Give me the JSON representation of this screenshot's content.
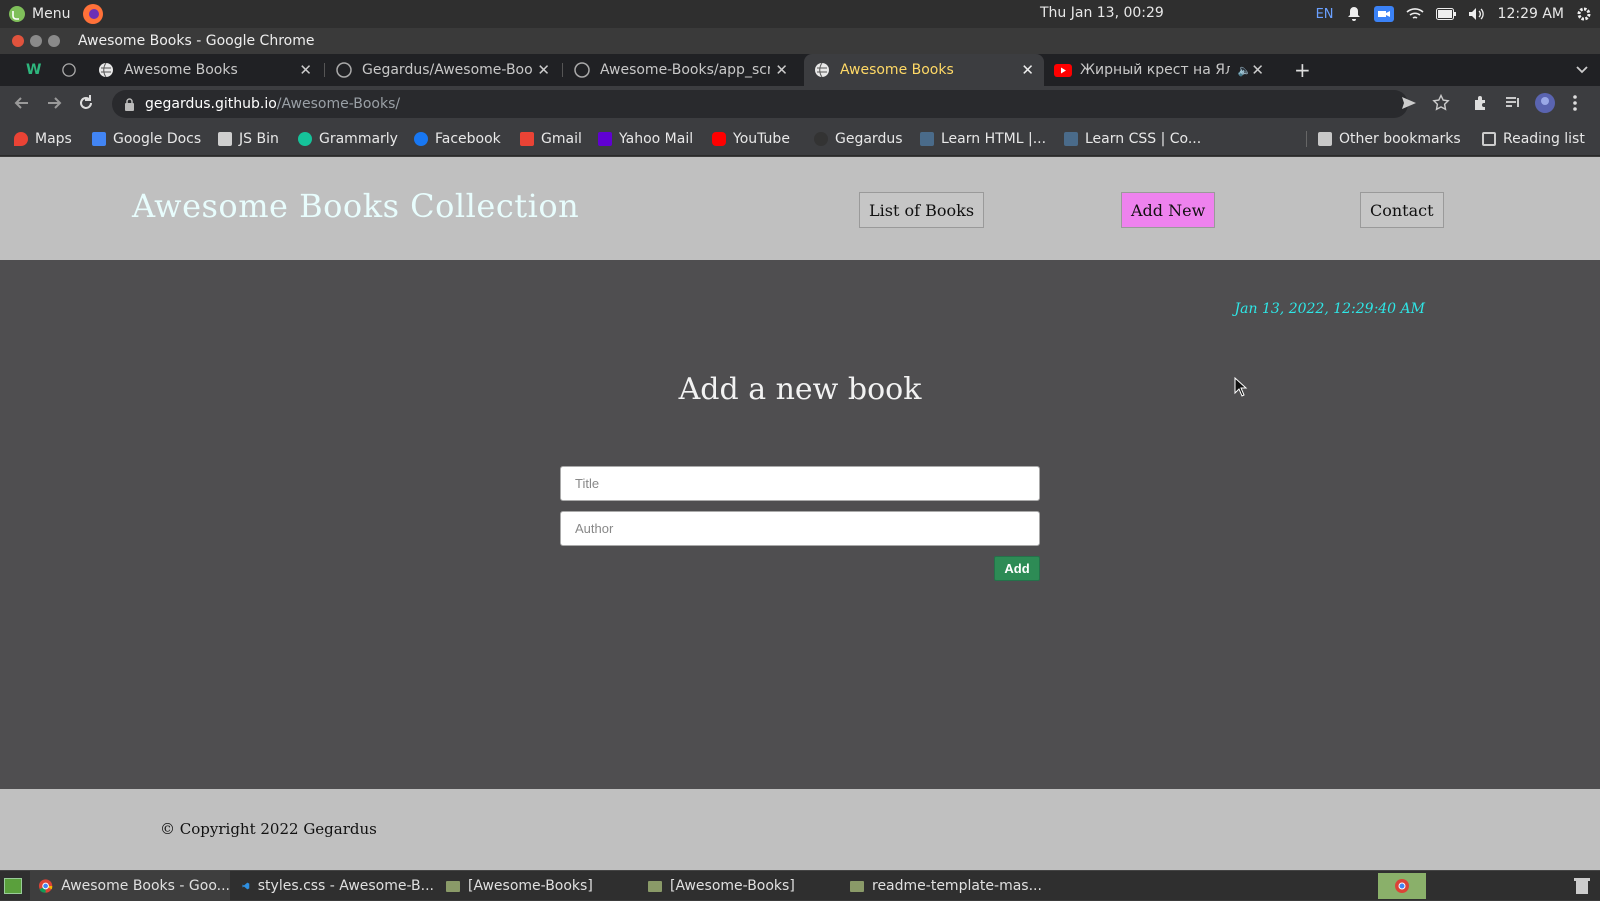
{
  "system_panel": {
    "menu_label": "Menu",
    "clock": "Thu Jan 13, 00:29",
    "lang": "EN",
    "time": "12:29 AM"
  },
  "window": {
    "title": "Awesome Books - Google Chrome"
  },
  "tabs": [
    {
      "label": "",
      "icon": "w-icon"
    },
    {
      "label": "",
      "icon": "github-icon"
    },
    {
      "label": "Awesome Books",
      "icon": "globe-icon"
    },
    {
      "label": "Gegardus/Awesome-Boo",
      "icon": "github-icon"
    },
    {
      "label": "Awesome-Books/app_scr",
      "icon": "github-icon"
    },
    {
      "label": "Awesome Books",
      "icon": "globe-icon",
      "active": true
    },
    {
      "label": "Жирный крест на Ялт",
      "icon": "youtube-icon",
      "muted": true
    }
  ],
  "address_bar": {
    "host": "gegardus.github.io",
    "path": "/Awesome-Books/"
  },
  "bookmarks": [
    {
      "label": "Maps",
      "color": "#ea4335"
    },
    {
      "label": "Google Docs",
      "color": "#4285f4"
    },
    {
      "label": "JS Bin",
      "color": "#cfcfcf"
    },
    {
      "label": "Grammarly",
      "color": "#15c39a"
    },
    {
      "label": "Facebook",
      "color": "#1877f2"
    },
    {
      "label": "Gmail",
      "color": "#ea4335"
    },
    {
      "label": "Yahoo Mail",
      "color": "#6001d2"
    },
    {
      "label": "YouTube",
      "color": "#ff0000"
    },
    {
      "label": "Gegardus",
      "color": "#333333"
    },
    {
      "label": "Learn HTML |...",
      "color": "#4a6b8a"
    },
    {
      "label": "Learn CSS | Co...",
      "color": "#4a6b8a"
    }
  ],
  "bookmarks_right": {
    "other": "Other bookmarks",
    "reading": "Reading list"
  },
  "site": {
    "brand": "Awesome Books Collection",
    "nav": {
      "list": "List of Books",
      "add": "Add New",
      "contact": "Contact"
    },
    "datetime": "Jan 13, 2022, 12:29:40 AM",
    "form": {
      "title": "Add a new book",
      "title_placeholder": "Title",
      "author_placeholder": "Author",
      "submit": "Add"
    },
    "footer": "© Copyright 2022 Gegardus"
  },
  "taskbar": {
    "items": [
      {
        "label": "Awesome Books - Goo..."
      },
      {
        "label": "styles.css - Awesome-B..."
      },
      {
        "label": "[Awesome-Books]"
      },
      {
        "label": "[Awesome-Books]"
      },
      {
        "label": "readme-template-mas..."
      }
    ]
  },
  "colors": {
    "accent_active_nav": "#ee82ee",
    "add_button": "#2d8b55",
    "datetime": "#2ee6e6",
    "page_bg": "#4f4e50",
    "header_bg": "#c0c0c0"
  }
}
